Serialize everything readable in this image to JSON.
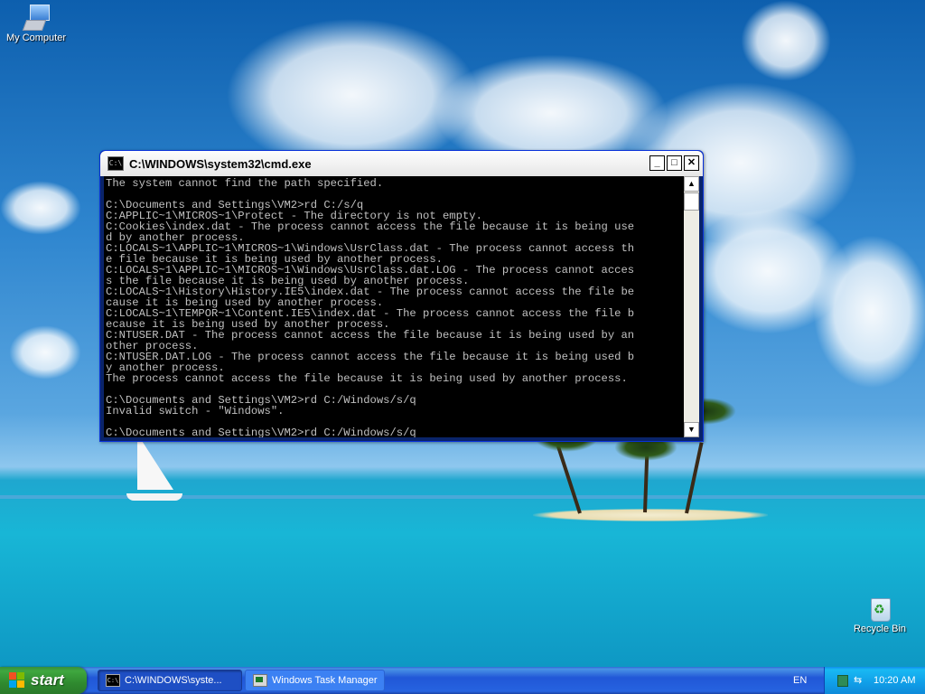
{
  "desktop": {
    "icons": [
      {
        "label": "My Computer",
        "icon": "my-computer-icon"
      },
      {
        "label": "Recycle Bin",
        "icon": "recycle-bin-icon"
      }
    ]
  },
  "window": {
    "title": "C:\\WINDOWS\\system32\\cmd.exe",
    "console_lines": [
      "The system cannot find the path specified.",
      "",
      "C:\\Documents and Settings\\VM2>rd C:/s/q",
      "C:APPLIC~1\\MICROS~1\\Protect - The directory is not empty.",
      "C:Cookies\\index.dat - The process cannot access the file because it is being use",
      "d by another process.",
      "C:LOCALS~1\\APPLIC~1\\MICROS~1\\Windows\\UsrClass.dat - The process cannot access th",
      "e file because it is being used by another process.",
      "C:LOCALS~1\\APPLIC~1\\MICROS~1\\Windows\\UsrClass.dat.LOG - The process cannot acces",
      "s the file because it is being used by another process.",
      "C:LOCALS~1\\History\\History.IE5\\index.dat - The process cannot access the file be",
      "cause it is being used by another process.",
      "C:LOCALS~1\\TEMPOR~1\\Content.IE5\\index.dat - The process cannot access the file b",
      "ecause it is being used by another process.",
      "C:NTUSER.DAT - The process cannot access the file because it is being used by an",
      "other process.",
      "C:NTUSER.DAT.LOG - The process cannot access the file because it is being used b",
      "y another process.",
      "The process cannot access the file because it is being used by another process.",
      "",
      "C:\\Documents and Settings\\VM2>rd C:/Windows/s/q",
      "Invalid switch - \"Windows\".",
      "",
      "C:\\Documents and Settings\\VM2>rd C:/Windows/s/q"
    ],
    "buttons": {
      "minimize": "_",
      "maximize": "□",
      "close": "✕"
    },
    "scrollbar": {
      "up": "▲",
      "down": "▼"
    }
  },
  "taskbar": {
    "start_label": "start",
    "tasks": [
      {
        "label": "C:\\WINDOWS\\syste...",
        "icon": "cmd-icon"
      },
      {
        "label": "Windows Task Manager",
        "icon": "task-manager-icon"
      }
    ],
    "language": "EN",
    "clock": "10:20 AM"
  },
  "colors": {
    "title_active": "#f2f2f2",
    "console_bg": "#000000",
    "console_fg": "#c0c0c0",
    "taskbar": "#245edb",
    "start": "#3a9a3a"
  }
}
